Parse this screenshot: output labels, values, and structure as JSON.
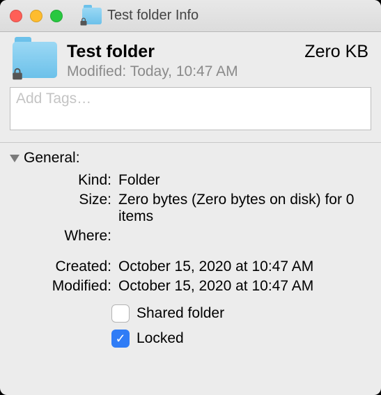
{
  "window": {
    "title": "Test folder Info"
  },
  "header": {
    "name": "Test folder",
    "modified_label": "Modified:",
    "modified_value": "Today, 10:47 AM",
    "size": "Zero KB"
  },
  "tags": {
    "placeholder": "Add Tags…",
    "value": ""
  },
  "section": {
    "general_label": "General:"
  },
  "fields": {
    "kind_label": "Kind:",
    "kind_value": "Folder",
    "size_label": "Size:",
    "size_value": "Zero bytes (Zero bytes on disk) for 0 items",
    "where_label": "Where:",
    "where_value": "",
    "created_label": "Created:",
    "created_value": "October 15, 2020 at 10:47 AM",
    "modified_label": "Modified:",
    "modified_value": "October 15, 2020 at 10:47 AM"
  },
  "checks": {
    "shared_label": "Shared folder",
    "shared_checked": false,
    "locked_label": "Locked",
    "locked_checked": true
  },
  "colors": {
    "accent": "#2f7cf6",
    "folder": "#7ecdef"
  }
}
